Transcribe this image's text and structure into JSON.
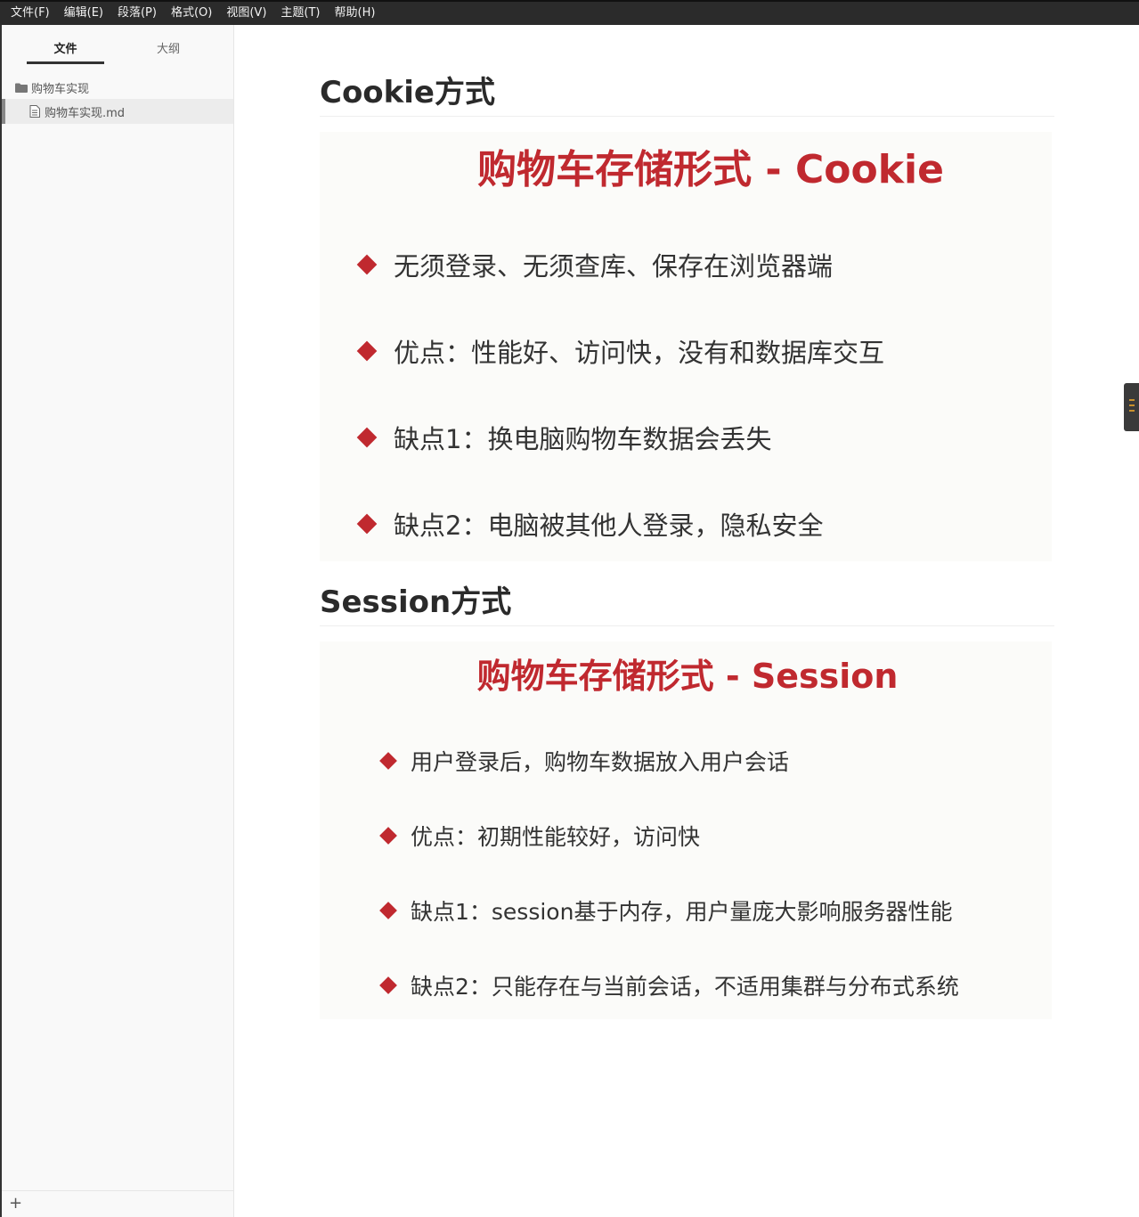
{
  "menubar": {
    "items": [
      "文件(F)",
      "编辑(E)",
      "段落(P)",
      "格式(O)",
      "视图(V)",
      "主题(T)",
      "帮助(H)"
    ]
  },
  "sidebar": {
    "tabs": {
      "files": "文件",
      "outline": "大纲"
    },
    "folder": "购物车实现",
    "file": "购物车实现.md",
    "add": "+"
  },
  "document": {
    "cookie_heading": "Cookie方式",
    "cookie_slide": {
      "title": "购物车存储形式 - Cookie",
      "bullets": [
        "无须登录、无须查库、保存在浏览器端",
        "优点：性能好、访问快，没有和数据库交互",
        "缺点1：换电脑购物车数据会丢失",
        "缺点2：电脑被其他人登录，隐私安全"
      ]
    },
    "session_heading": "Session方式",
    "session_slide": {
      "title": "购物车存储形式 - Session",
      "bullets": [
        "用户登录后，购物车数据放入用户会话",
        "优点：初期性能较好，访问快",
        "缺点1：session基于内存，用户量庞大影响服务器性能",
        "缺点2：只能存在与当前会话，不适用集群与分布式系统"
      ]
    }
  },
  "colors": {
    "accent_red": "#c0292f",
    "menubar_bg": "#2b2b2b",
    "sidebar_bg": "#f9f9f9"
  },
  "icons": {
    "folder": "folder-icon",
    "file": "file-icon",
    "bullet": "diamond-icon"
  }
}
